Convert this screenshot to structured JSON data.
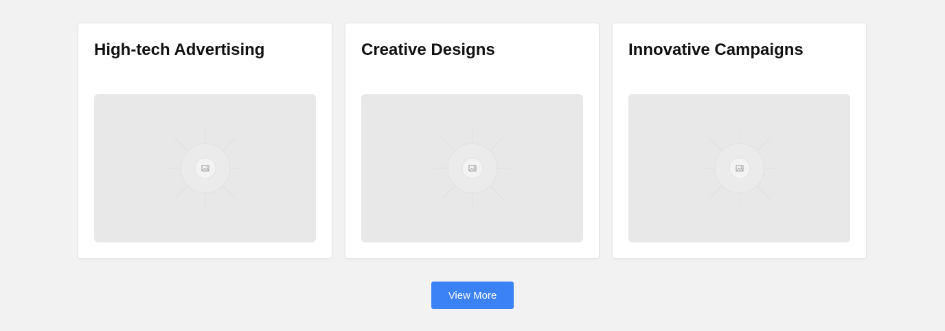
{
  "cards": [
    {
      "title": "High-tech Advertising",
      "image_icon": "image-placeholder-icon"
    },
    {
      "title": "Creative Designs",
      "image_icon": "image-placeholder-icon"
    },
    {
      "title": "Innovative Campaigns",
      "image_icon": "image-placeholder-icon"
    }
  ],
  "actions": {
    "view_more_label": "View More"
  },
  "colors": {
    "page_background": "#f2f2f2",
    "card_background": "#ffffff",
    "placeholder_background": "#e8e8e8",
    "button_accent": "#3b82f6"
  }
}
